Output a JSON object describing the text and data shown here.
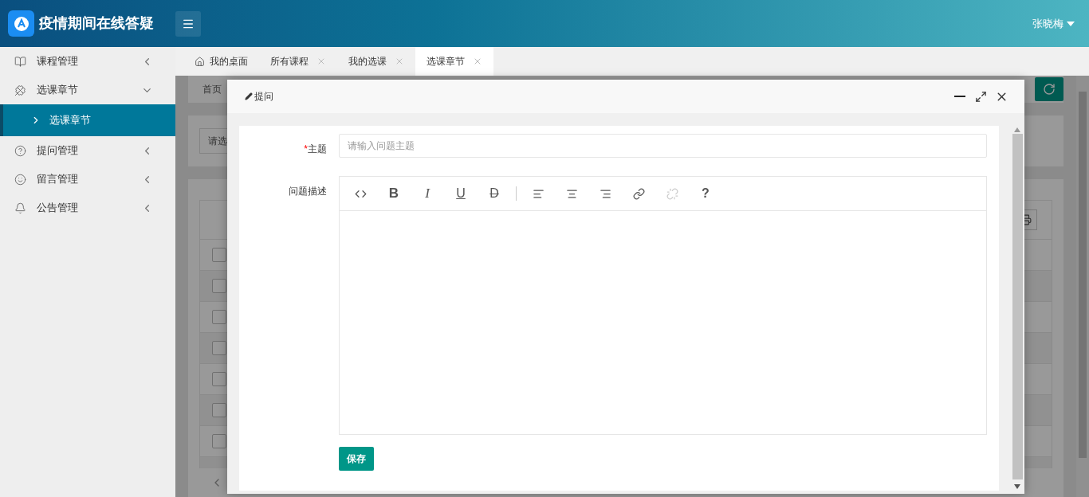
{
  "header": {
    "title": "疫情期间在线答疑",
    "user": "张晓梅"
  },
  "sidebar": {
    "items": [
      {
        "label": "课程管理",
        "expanded": false
      },
      {
        "label": "选课章节",
        "expanded": true,
        "children": [
          {
            "label": "选课章节",
            "selected": true
          }
        ]
      },
      {
        "label": "提问管理",
        "expanded": false
      },
      {
        "label": "留言管理",
        "expanded": false
      },
      {
        "label": "公告管理",
        "expanded": false
      }
    ]
  },
  "tabs": [
    {
      "label": "我的桌面",
      "selected": false,
      "closable": false
    },
    {
      "label": "所有课程",
      "selected": false,
      "closable": true
    },
    {
      "label": "我的选课",
      "selected": false,
      "closable": true
    },
    {
      "label": "选课章节",
      "selected": true,
      "closable": true
    }
  ],
  "background_page": {
    "breadcrumb": "首页",
    "select_placeholder": "请选",
    "rows": [
      {
        "checked": false
      },
      {
        "checked": false
      },
      {
        "checked": false
      },
      {
        "checked": false
      },
      {
        "checked": false
      },
      {
        "checked": false
      },
      {
        "checked": false
      }
    ]
  },
  "dialog": {
    "title": "提问",
    "fields": [
      {
        "kind": "input",
        "label": "主题",
        "required_mark": "*",
        "placeholder": "请输入问题主题"
      },
      {
        "kind": "editor",
        "label": "问题描述"
      }
    ],
    "toolbar": [
      {
        "kind": "code",
        "disabled": false
      },
      {
        "kind": "bold",
        "glyph": "B",
        "disabled": false
      },
      {
        "kind": "italic",
        "glyph": "I",
        "disabled": false
      },
      {
        "kind": "underline",
        "glyph": "U",
        "disabled": false
      },
      {
        "kind": "strike",
        "glyph": "D",
        "disabled": false
      },
      {
        "kind": "separator"
      },
      {
        "kind": "align-left",
        "disabled": false
      },
      {
        "kind": "align-center",
        "disabled": false
      },
      {
        "kind": "align-right",
        "disabled": false
      },
      {
        "kind": "link",
        "disabled": false
      },
      {
        "kind": "unlink",
        "disabled": true
      },
      {
        "kind": "help",
        "glyph": "?",
        "disabled": false
      }
    ],
    "button": "保存"
  }
}
